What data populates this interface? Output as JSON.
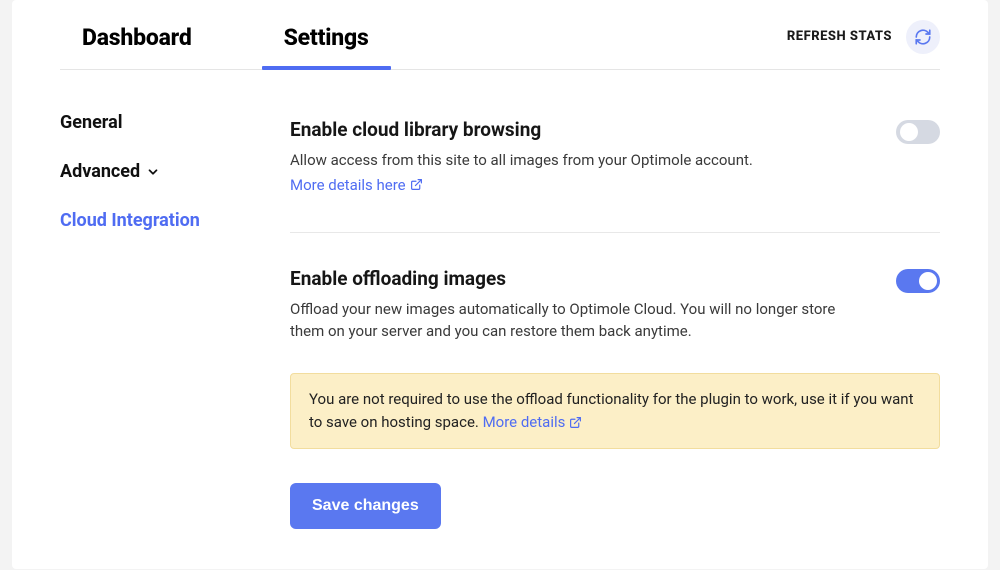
{
  "tabs": {
    "dashboard": "Dashboard",
    "settings": "Settings"
  },
  "header": {
    "refresh_stats": "REFRESH STATS"
  },
  "sidebar": {
    "general": "General",
    "advanced": "Advanced",
    "cloud_integration": "Cloud Integration"
  },
  "settings": {
    "cloud_library": {
      "title": "Enable cloud library browsing",
      "desc": "Allow access from this site to all images from your Optimole account.",
      "link": "More details here"
    },
    "offloading": {
      "title": "Enable offloading images",
      "desc": "Offload your new images automatically to Optimole Cloud. You will no longer store them on your server and you can restore them back anytime."
    },
    "notice": {
      "text": "You are not required to use the offload functionality for the plugin to work, use it if you want to save on hosting space. ",
      "link": "More details"
    }
  },
  "buttons": {
    "save": "Save changes"
  }
}
